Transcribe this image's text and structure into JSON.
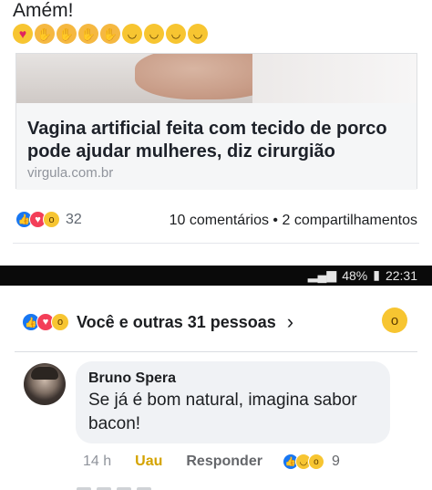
{
  "post": {
    "text": "Amém!",
    "emojis": [
      "😍",
      "👏",
      "👏",
      "👏",
      "👏",
      "😂",
      "😂",
      "😂",
      "😂"
    ]
  },
  "link": {
    "title_line1": "Vagina artificial feita com tecido de porco",
    "title_line2": "pode ajudar mulheres, diz cirurgião",
    "domain": "virgula.com.br"
  },
  "post_reactions": {
    "count": "32",
    "stats": "10 comentários • 2 compartilhamentos"
  },
  "status_bar": {
    "time": "22:31",
    "battery": "48%"
  },
  "likes_panel": {
    "text": "Você e outras 31 pessoas",
    "chevron": "›"
  },
  "comment": {
    "author": "Bruno Spera",
    "line1": "Se já é bom natural, imagina sabor",
    "line2": "bacon!",
    "time": "14 h",
    "reaction_action": "Uau",
    "reply": "Responder",
    "reaction_count": "9"
  },
  "colors": {
    "like_blue": "#1877f2",
    "love_red": "#f33e58",
    "wow_yellow": "#f7c531",
    "uau_text": "#d4a300"
  }
}
